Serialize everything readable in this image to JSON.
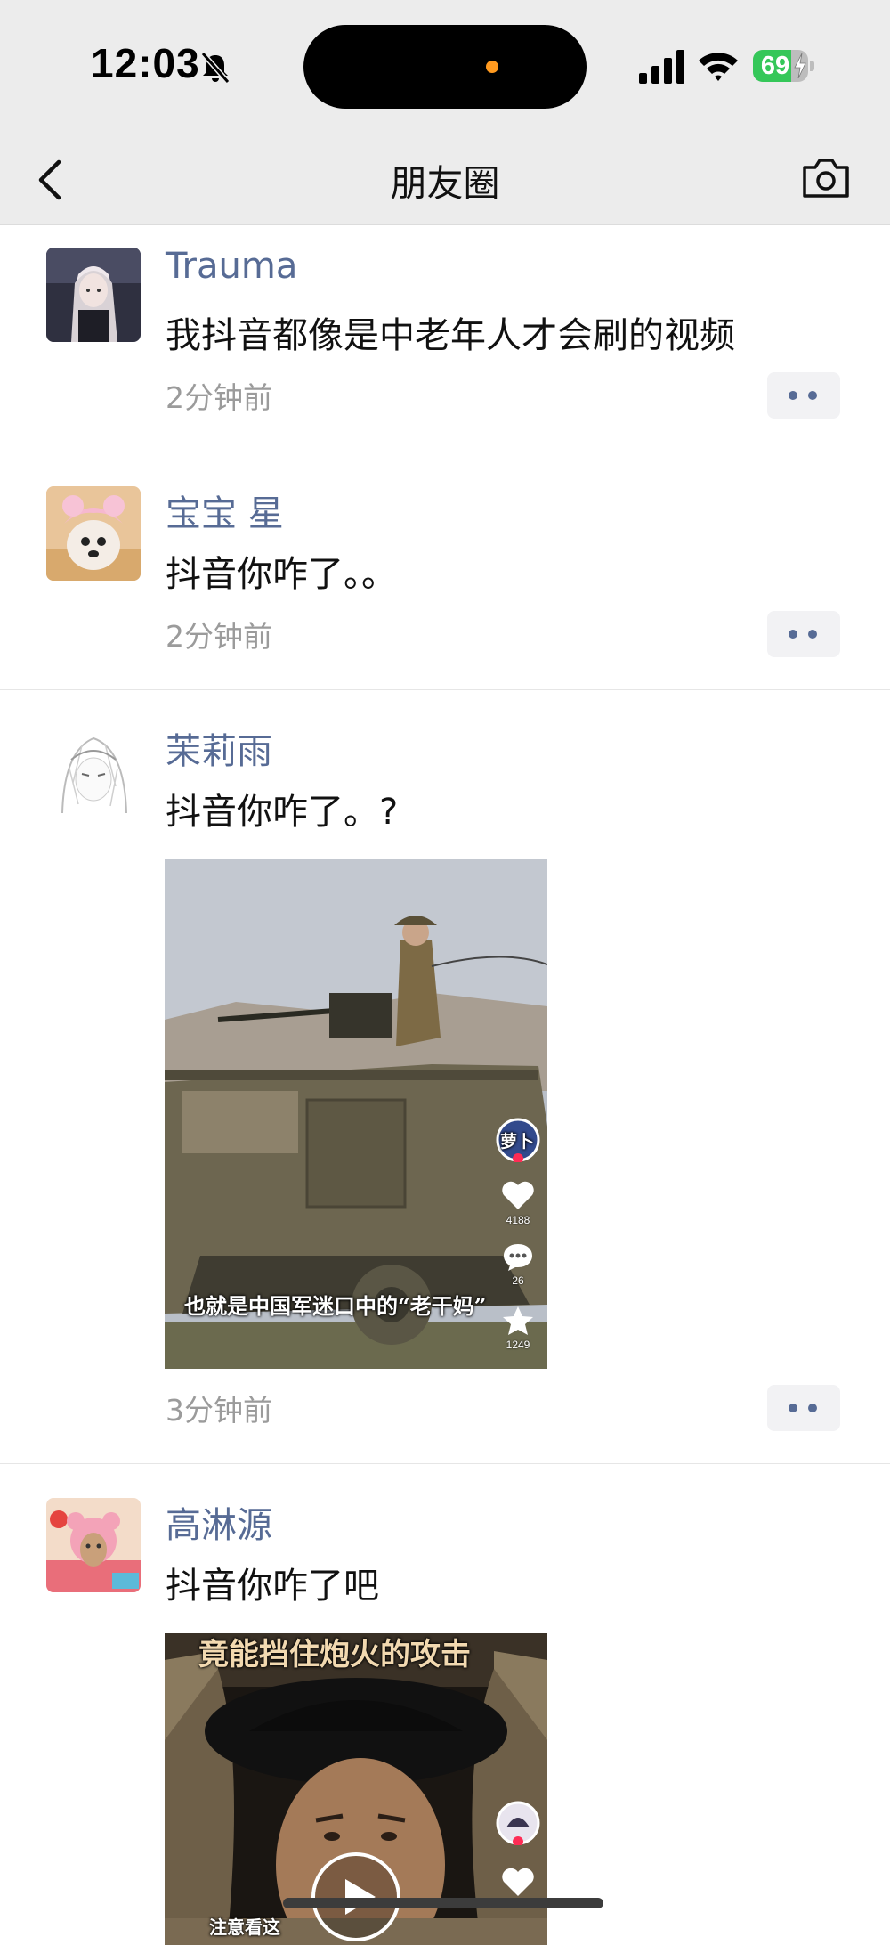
{
  "status_bar": {
    "time": "12:03",
    "battery": "69",
    "battery_level": 0.69,
    "icons": [
      "bell-muted-icon",
      "signal-icon",
      "wifi-icon",
      "battery-icon",
      "charging-bolt-icon"
    ],
    "colors": {
      "battery": "#35c759",
      "island_dot": "#ff9a1f"
    }
  },
  "nav": {
    "title": "朋友圈",
    "back_icon": "chevron-left-icon",
    "camera_icon": "camera-icon"
  },
  "colors": {
    "name": "#576b95",
    "time": "#9b9b9b",
    "background": "#ececec"
  },
  "posts": [
    {
      "name": "Trauma",
      "text": "我抖音都像是中老年人才会刷的视频",
      "time": "2分钟前",
      "avatar": "avatar-gothic-doll"
    },
    {
      "name": "宝宝 星",
      "text": "抖音你咋了。。",
      "time": "2分钟前",
      "avatar": "avatar-puppy-pink-hat"
    },
    {
      "name": "茉莉雨",
      "text": "抖音你咋了。?",
      "time": "3分钟前",
      "avatar": "avatar-anime-sketch",
      "video": {
        "caption": "也就是中国军迷口中的“老干妈”",
        "creator_badge": "萝卜",
        "likes": "4188",
        "comments": "26",
        "favorites": "1249"
      }
    },
    {
      "name": "高淋源",
      "text": "抖音你咋了吧",
      "avatar": "avatar-cartoon-bear-girl",
      "video": {
        "top_caption": "竟能挡住炮火的攻击",
        "caption": "注意看这"
      }
    }
  ]
}
